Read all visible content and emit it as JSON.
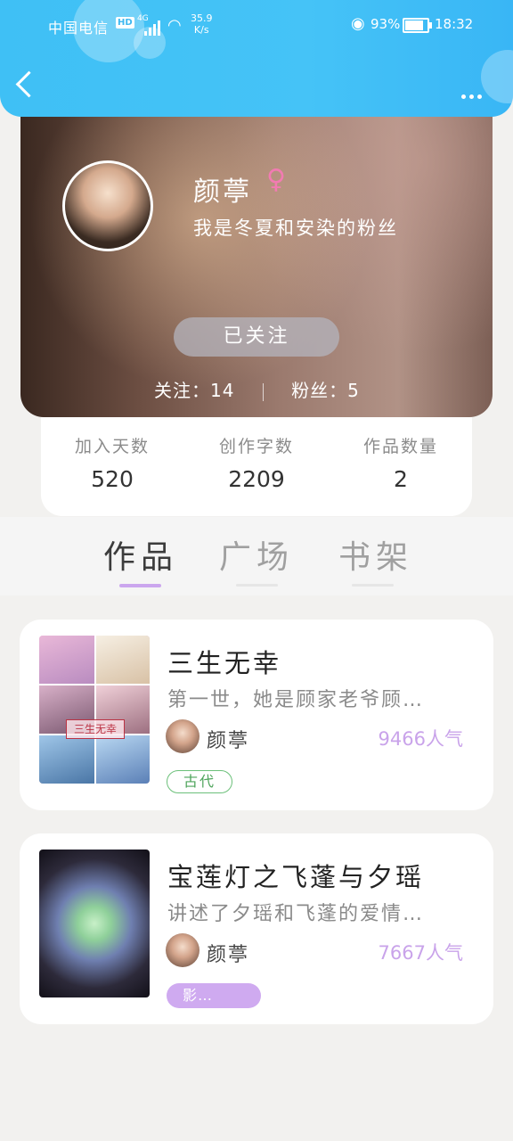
{
  "status_bar": {
    "carrier": "中国电信",
    "hd": "HD",
    "network": "4G",
    "speed_value": "35.9",
    "speed_unit": "K/s",
    "battery_pct": "93%",
    "battery_level": 0.93,
    "time": "18:32"
  },
  "profile": {
    "name": "颜葶",
    "gender_symbol": "♀",
    "bio": "我是冬夏和安染的粉丝",
    "follow_button": "已关注",
    "following_label": "关注：",
    "following_count": "14",
    "fans_label": "粉丝：",
    "fans_count": "5"
  },
  "stats": [
    {
      "label": "加入天数",
      "value": "520"
    },
    {
      "label": "创作字数",
      "value": "2209"
    },
    {
      "label": "作品数量",
      "value": "2"
    }
  ],
  "tabs": [
    {
      "label": "作品",
      "active": true
    },
    {
      "label": "广场",
      "active": false
    },
    {
      "label": "书架",
      "active": false
    }
  ],
  "works": [
    {
      "title": "三生无幸",
      "description": "第一世，她是顾家老爷顾…",
      "author": "颜葶",
      "popularity": "9466人气",
      "tag": "古代",
      "cover_text": "三生无幸"
    },
    {
      "title": "宝莲灯之飞蓬与夕瑶",
      "description": "讲述了夕瑶和飞蓬的爱情…",
      "author": "颜葶",
      "popularity": "7667人气",
      "tag": "影…"
    }
  ],
  "colors": {
    "header": "#42c1f6",
    "accent_purple": "#c9a3ea",
    "tag_green": "#6cc07a",
    "gender_pink": "#f27bb2"
  },
  "icons": [
    "back-icon",
    "more-icon",
    "eye-icon",
    "wifi-icon",
    "signal-icon",
    "battery-icon"
  ]
}
